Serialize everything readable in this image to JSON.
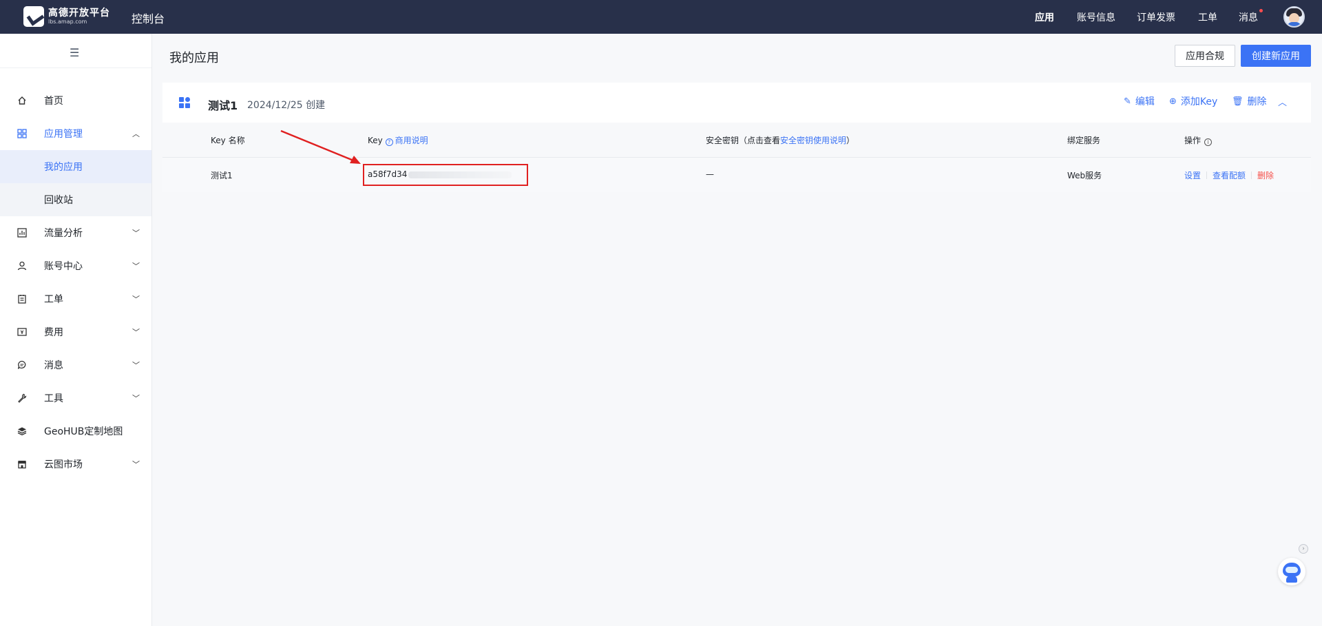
{
  "header": {
    "logo_text": "高德开放平台",
    "logo_sub": "lbs.amap.com",
    "console": "控制台",
    "nav": [
      "应用",
      "账号信息",
      "订单发票",
      "工单",
      "消息"
    ]
  },
  "sidebar": {
    "items": [
      {
        "label": "首页",
        "icon": "home-icon"
      },
      {
        "label": "应用管理",
        "icon": "apps-icon"
      },
      {
        "label": "我的应用"
      },
      {
        "label": "回收站"
      },
      {
        "label": "流量分析",
        "icon": "chart-icon"
      },
      {
        "label": "账号中心",
        "icon": "user-icon"
      },
      {
        "label": "工单",
        "icon": "ticket-icon"
      },
      {
        "label": "费用",
        "icon": "money-icon"
      },
      {
        "label": "消息",
        "icon": "message-icon"
      },
      {
        "label": "工具",
        "icon": "wrench-icon"
      },
      {
        "label": "GeoHUB定制地图",
        "icon": "layers-icon"
      },
      {
        "label": "云图市场",
        "icon": "store-icon"
      }
    ]
  },
  "main": {
    "title": "我的应用",
    "compliance_button": "应用合规",
    "create_button": "创建新应用",
    "app": {
      "name": "测试1",
      "created": "2024/12/25 创建",
      "actions": {
        "edit": "编辑",
        "add_key": "添加Key",
        "delete": "删除"
      }
    },
    "table": {
      "headers": {
        "key_name": "Key 名称",
        "key": "Key",
        "key_help": "商用说明",
        "secret_prefix": "安全密钥（点击查看",
        "secret_link": "安全密钥使用说明",
        "secret_suffix": "）",
        "service": "绑定服务",
        "ops": "操作"
      },
      "rows": [
        {
          "key_name": "测试1",
          "key": "a58f7d34",
          "secret": "—",
          "service": "Web服务",
          "ops": {
            "settings": "设置",
            "quota": "查看配额",
            "delete": "删除"
          }
        }
      ]
    }
  },
  "colors": {
    "accent": "#3b73f5",
    "topbar": "#28304a",
    "danger": "#f5504a",
    "annotation": "#e02020"
  }
}
